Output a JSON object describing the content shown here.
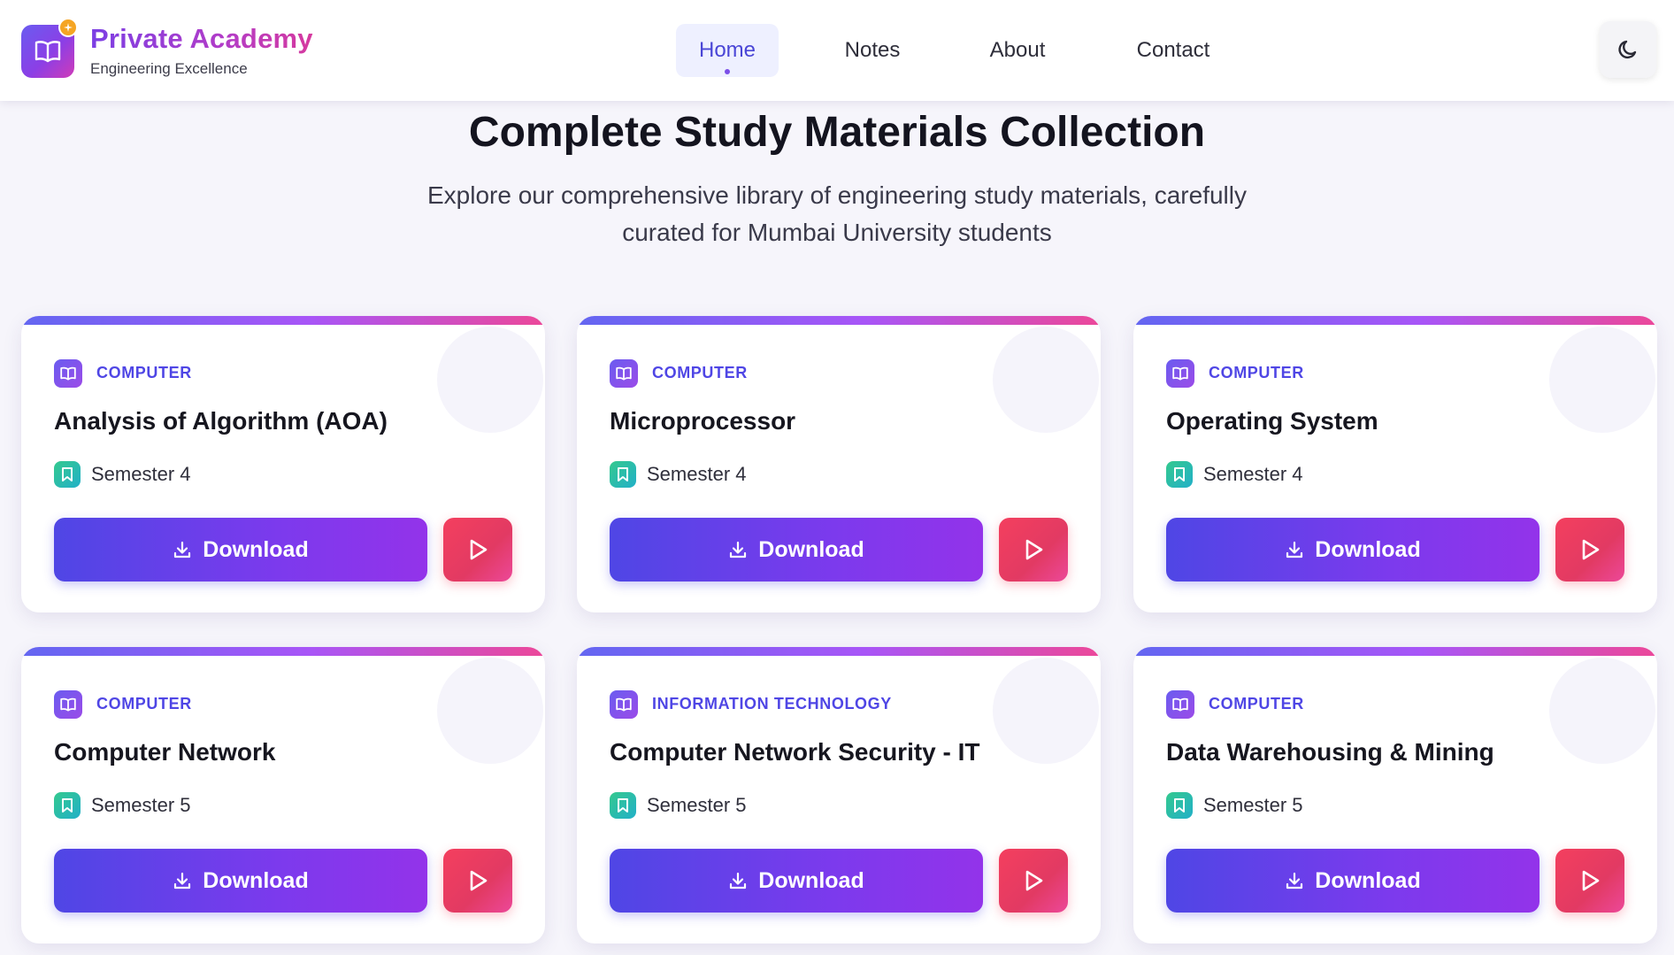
{
  "brand": {
    "name": "Private Academy",
    "tagline": "Engineering Excellence",
    "logo_icon": "open-book-icon",
    "badge_icon": "sparkle-icon"
  },
  "nav": {
    "items": [
      {
        "label": "Home",
        "active": true
      },
      {
        "label": "Notes",
        "active": false
      },
      {
        "label": "About",
        "active": false
      },
      {
        "label": "Contact",
        "active": false
      }
    ],
    "theme_toggle_icon": "moon-icon"
  },
  "hero": {
    "title": "Complete Study Materials Collection",
    "subtitle": "Explore our comprehensive library of engineering study materials, carefully curated for Mumbai University students"
  },
  "cards": [
    {
      "category": "COMPUTER",
      "title": "Analysis of Algorithm (AOA)",
      "semester": "Semester 4",
      "download_label": "Download"
    },
    {
      "category": "COMPUTER",
      "title": "Microprocessor",
      "semester": "Semester 4",
      "download_label": "Download"
    },
    {
      "category": "COMPUTER",
      "title": "Operating System",
      "semester": "Semester 4",
      "download_label": "Download"
    },
    {
      "category": "COMPUTER",
      "title": "Computer Network",
      "semester": "Semester 5",
      "download_label": "Download"
    },
    {
      "category": "INFORMATION TECHNOLOGY",
      "title": "Computer Network Security - IT",
      "semester": "Semester 5",
      "download_label": "Download"
    },
    {
      "category": "COMPUTER",
      "title": "Data Warehousing & Mining",
      "semester": "Semester 5",
      "download_label": "Download"
    }
  ],
  "colors": {
    "accent": "#4f46e5",
    "accent_purple": "#9333ea",
    "play_red": "#f43f5e",
    "semester_green": "#34c98e"
  }
}
